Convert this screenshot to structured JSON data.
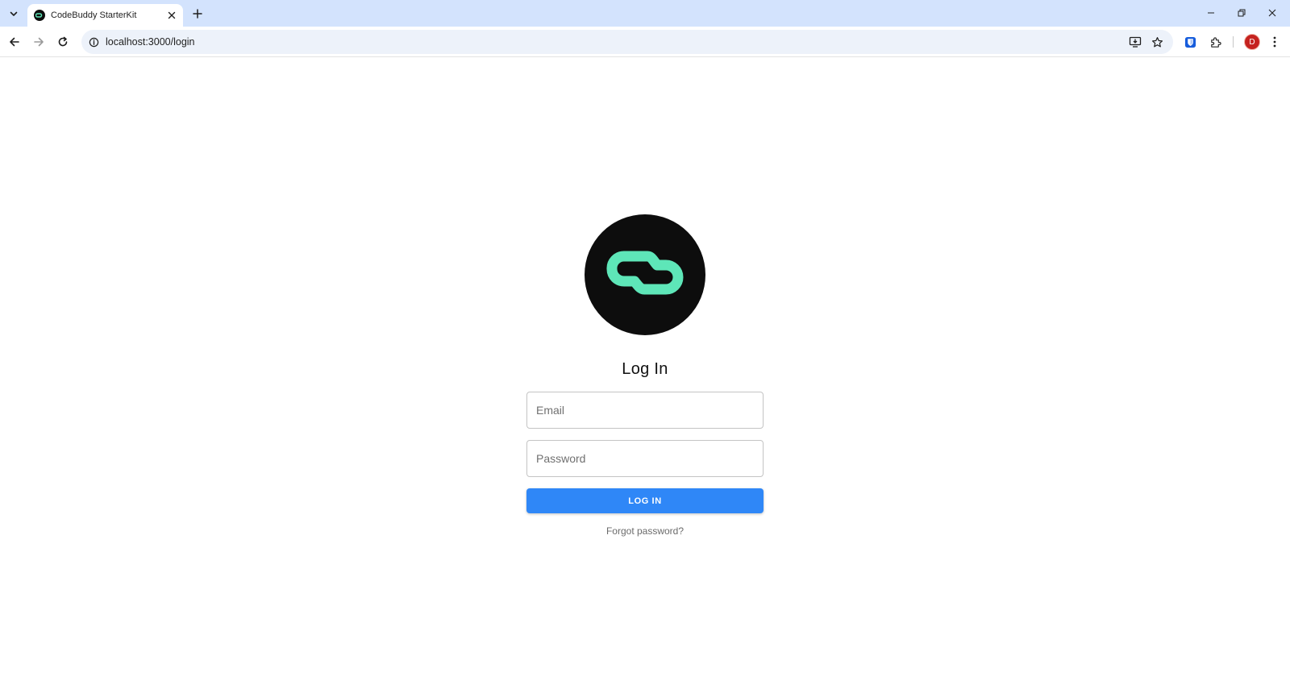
{
  "browser": {
    "tab": {
      "title": "CodeBuddy StarterKit"
    },
    "address_bar": {
      "url": "localhost:3000/login"
    },
    "profile": {
      "initial": "D"
    }
  },
  "login": {
    "title": "Log In",
    "email": {
      "placeholder": "Email",
      "value": ""
    },
    "password": {
      "placeholder": "Password",
      "value": ""
    },
    "submit_label": "LOG IN",
    "forgot_label": "Forgot password?"
  },
  "colors": {
    "accent": "#2f87f7",
    "logo_background": "#0d0d0d",
    "logo_mark": "#5ee6b8",
    "tabstrip": "#d3e3fd"
  },
  "icons": {
    "logo": "codebuddy-logo",
    "browser": [
      "tab-search-icon",
      "close-icon",
      "plus-icon",
      "minimize-icon",
      "restore-icon",
      "back-arrow-icon",
      "forward-arrow-icon",
      "reload-icon",
      "site-info-icon",
      "install-app-icon",
      "star-icon",
      "bitwarden-icon",
      "puzzle-extension-icon",
      "kebab-menu-icon"
    ]
  }
}
